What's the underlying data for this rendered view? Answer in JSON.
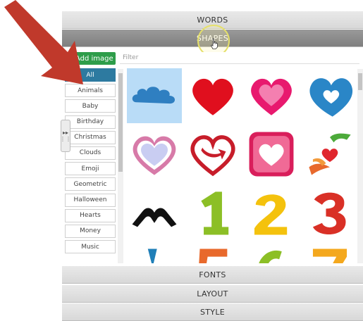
{
  "panels": {
    "words": "WORDS",
    "shapes": "SHAPES",
    "fonts": "FONTS",
    "layout": "LAYOUT",
    "style": "STYLE"
  },
  "toolbar": {
    "add_image_label": "+ Add image",
    "filter_placeholder": "Filter"
  },
  "categories": [
    "All",
    "Animals",
    "Baby",
    "Birthday",
    "Christmas",
    "Clouds",
    "Emoji",
    "Geometric",
    "Halloween",
    "Hearts",
    "Money",
    "Music"
  ],
  "selected_category": "All",
  "shapes": [
    {
      "name": "cloud",
      "color": "#2f7fc1"
    },
    {
      "name": "heart",
      "color": "#e00f1e"
    },
    {
      "name": "heart-double",
      "color": "#e8196e"
    },
    {
      "name": "heart-outline-blue",
      "color": "#2a86c7"
    },
    {
      "name": "heart-double-outline",
      "color": "#d77aa8"
    },
    {
      "name": "heart-arrow",
      "color": "#c71d2a"
    },
    {
      "name": "heart-square",
      "color": "#d91e5b"
    },
    {
      "name": "hands-heart",
      "color": "#e8692c"
    },
    {
      "name": "hand-heart-gesture",
      "color": "#111111"
    },
    {
      "name": "number-one",
      "color": "#8cbf26"
    },
    {
      "name": "number-two",
      "color": "#f4c20d"
    },
    {
      "name": "number-three",
      "color": "#d93026"
    }
  ],
  "accent": "#2e9d4a",
  "active_category_color": "#2d7aa0",
  "selected_tile_color": "#b9dcf7"
}
